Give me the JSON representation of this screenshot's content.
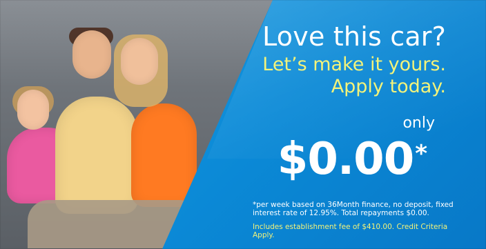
{
  "ad": {
    "headline_line1": "Love this car?",
    "headline_line2": "Let’s make it yours.",
    "headline_line3": "Apply today.",
    "only_label": "only",
    "price": "$0.00",
    "price_asterisk": "*",
    "fineprint": "*per week based on 36Month finance, no deposit, fixed interest rate of 12.95%. Total repayments $0.00.",
    "fineprint_yellow": "Includes establishment fee of $410.00. Credit Criteria Apply."
  },
  "colors": {
    "panel_blue": "#0b89d6",
    "headline_white": "#ffffff",
    "accent_yellow": "#f3f37a"
  }
}
